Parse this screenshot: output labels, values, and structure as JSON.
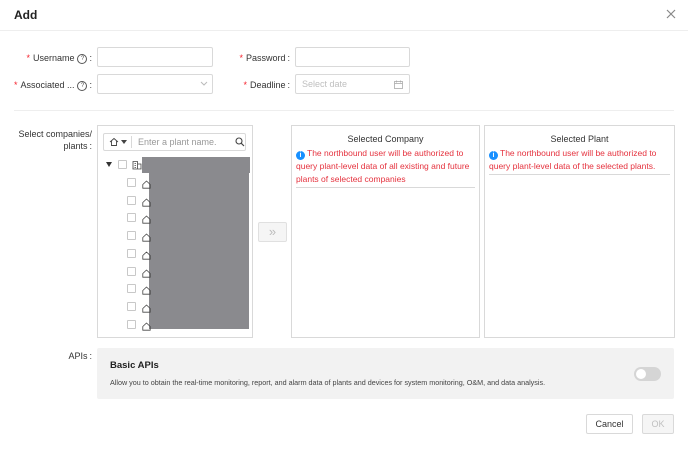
{
  "dialog": {
    "title": "Add"
  },
  "form": {
    "username_label": "Username",
    "password_label": "Password",
    "associated_label": "Associated ...",
    "deadline_label": "Deadline",
    "deadline_placeholder": "Select date",
    "username_value": "",
    "password_value": "",
    "associated_value": ""
  },
  "selection": {
    "label_line1": "Select companies/",
    "label_line2": "plants",
    "search_placeholder": "Enter a plant name.",
    "transfer_symbol": "»",
    "tree_row_count": 9
  },
  "selected_company": {
    "title": "Selected Company",
    "message": "The northbound user will be authorized to query plant-level data of all existing and future plants of selected companies"
  },
  "selected_plant": {
    "title": "Selected Plant",
    "message": "The northbound user will be authorized to query plant-level data of the selected plants."
  },
  "apis": {
    "label": "APIs",
    "basic_title": "Basic APIs",
    "basic_desc": "Allow you to obtain the real-time monitoring, report, and alarm data of plants and devices for system monitoring, O&M, and data analysis.",
    "basic_enabled": false
  },
  "footer": {
    "cancel_label": "Cancel",
    "ok_label": "OK"
  },
  "colors": {
    "required": "#f5222d",
    "message": "#e5323e",
    "info": "#1890ff",
    "masked": "#8a8a8e"
  }
}
